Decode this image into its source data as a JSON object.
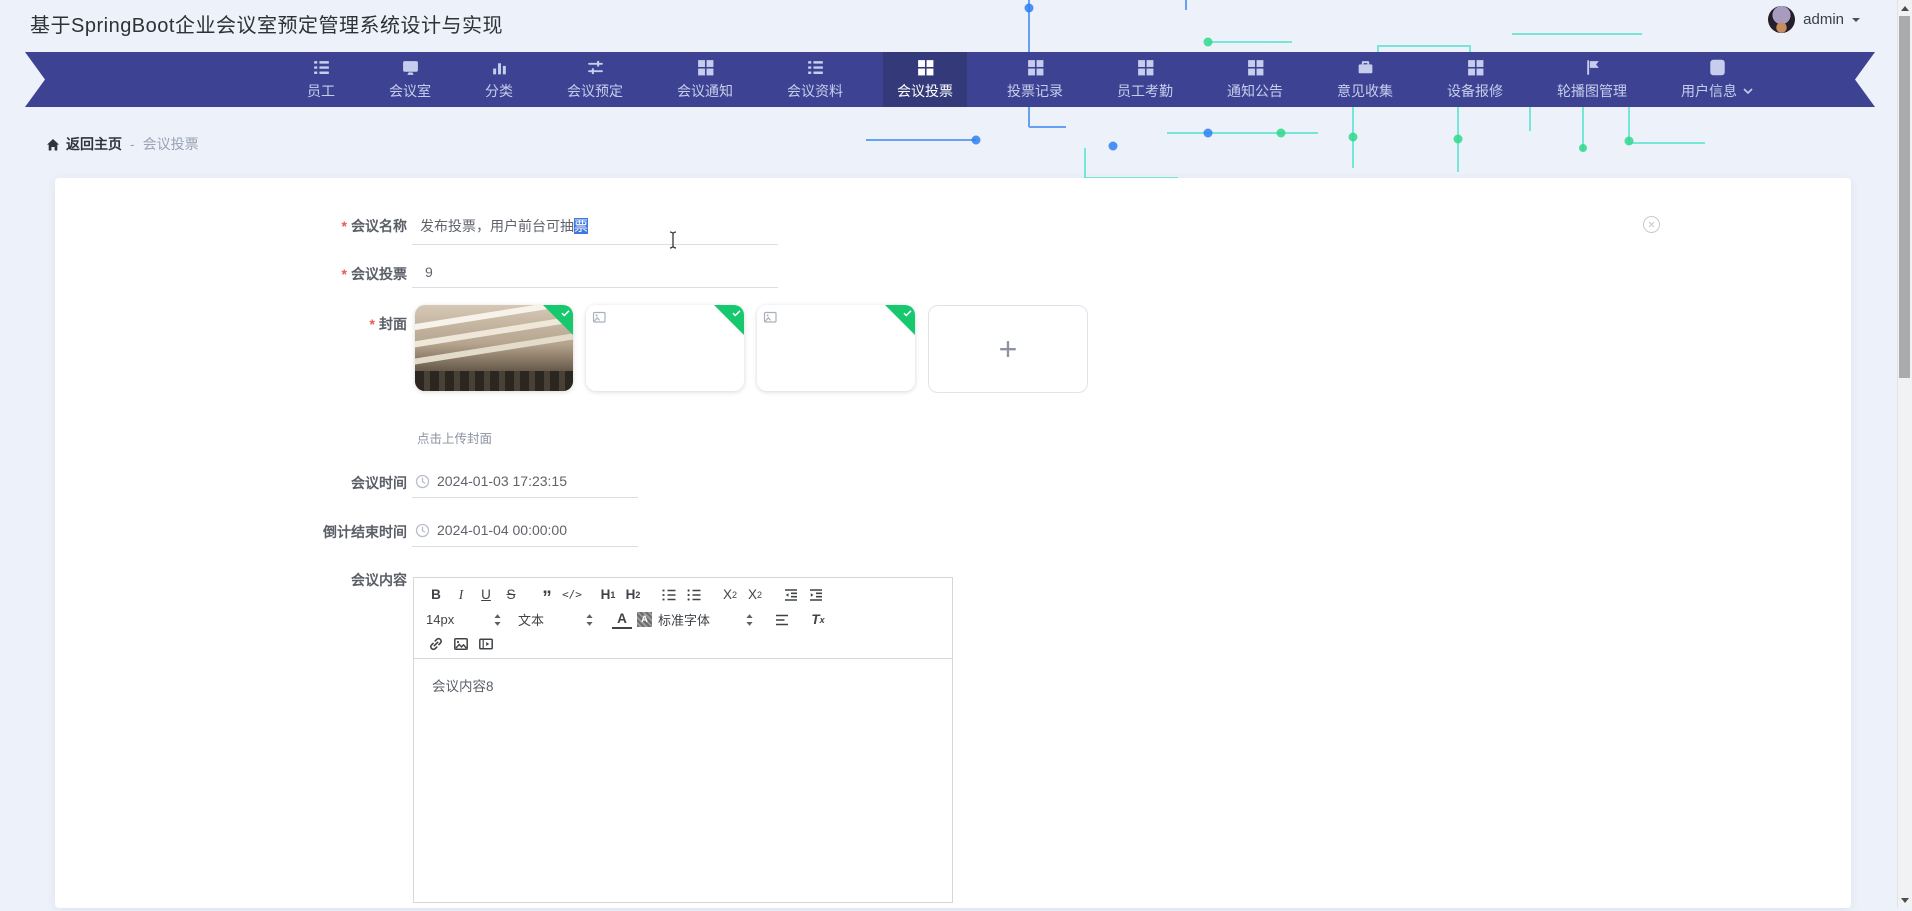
{
  "header": {
    "title": "基于SpringBoot企业会议室预定管理系统设计与实现",
    "user": {
      "name": "admin"
    }
  },
  "nav": {
    "items": [
      {
        "label": "员工",
        "icon": "list-icon",
        "active": false
      },
      {
        "label": "会议室",
        "icon": "screen-icon",
        "active": false
      },
      {
        "label": "分类",
        "icon": "bar-chart-icon",
        "active": false
      },
      {
        "label": "会议预定",
        "icon": "sliders-icon",
        "active": false
      },
      {
        "label": "会议通知",
        "icon": "grid-icon",
        "active": false
      },
      {
        "label": "会议资料",
        "icon": "list-icon",
        "active": false
      },
      {
        "label": "会议投票",
        "icon": "grid-icon",
        "active": true
      },
      {
        "label": "投票记录",
        "icon": "grid-icon",
        "active": false
      },
      {
        "label": "员工考勤",
        "icon": "grid-icon",
        "active": false
      },
      {
        "label": "通知公告",
        "icon": "grid-icon",
        "active": false
      },
      {
        "label": "意见收集",
        "icon": "briefcase-icon",
        "active": false
      },
      {
        "label": "设备报修",
        "icon": "grid-icon",
        "active": false
      },
      {
        "label": "轮播图管理",
        "icon": "flag-icon",
        "active": false
      },
      {
        "label": "用户信息",
        "icon": "id-card-icon",
        "active": false
      }
    ]
  },
  "breadcrumb": {
    "home": "返回主页",
    "separator": "-",
    "current": "会议投票"
  },
  "form": {
    "required_mark": "*",
    "meeting_name": {
      "label": "会议名称",
      "value": "发布投票，用户前台可抽票",
      "value_before": "发布投票，用户前台可抽",
      "value_selected": "票"
    },
    "meeting_vote": {
      "label": "会议投票",
      "value": "9"
    },
    "cover": {
      "label": "封面",
      "hint": "点击上传封面",
      "add_label": "+",
      "images": [
        {
          "name": "meeting-room-photo",
          "state": "uploaded"
        },
        {
          "name": "broken-image",
          "state": "uploaded"
        },
        {
          "name": "broken-image",
          "state": "uploaded"
        }
      ]
    },
    "meeting_time": {
      "label": "会议时间",
      "value": "2024-01-03 17:23:15"
    },
    "countdown_end": {
      "label": "倒计结束时间",
      "value": "2024-01-04 00:00:00"
    },
    "content": {
      "label": "会议内容",
      "text": "会议内容8"
    }
  },
  "editor": {
    "toolbar": {
      "bold": "B",
      "italic": "I",
      "underline": "U",
      "strike": "S",
      "quote": "”",
      "code": "</>",
      "heading": "H",
      "h1_num": "1",
      "h2_num": "2",
      "sub_base": "X",
      "sub_num": "2",
      "sup_base": "X",
      "sup_num": "2",
      "size": "14px",
      "text_style": "文本",
      "color_letter": "A",
      "highlight_letter": "A",
      "font": "标准字体",
      "clear_t": "T",
      "clear_x": "x"
    }
  },
  "icons": {
    "breadcrumb_home": "home-icon",
    "date_fields": "clock-icon",
    "card_corner": "close-circle-icon",
    "thumbnail_status": "check-icon",
    "user_menu": "caret-down-icon"
  },
  "colors": {
    "page_bg": "#edf1f9",
    "nav_bg": "#3d4392",
    "nav_active_bg": "#343a79",
    "success_green": "#17c86e",
    "selection_blue": "#3e78e0",
    "required_red": "#f0584a"
  }
}
